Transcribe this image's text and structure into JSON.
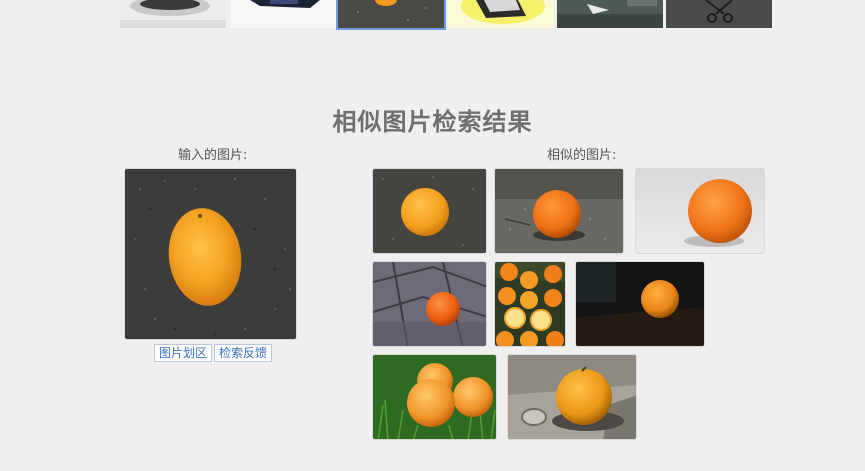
{
  "page": {
    "title": "相似图片检索结果"
  },
  "input_section": {
    "label": "输入的图片:",
    "buttons": {
      "crop": "图片划区",
      "feedback": "检索反馈"
    }
  },
  "similar_section": {
    "label": "相似的图片:"
  },
  "colors": {
    "background": "#efefef",
    "selected_outline": "#6a9fe6",
    "link_blue": "#3a6fbe",
    "orange": "#f08a1c"
  },
  "thumbnail_strip": {
    "selected_index": 2,
    "items": [
      "bowl-thumbnail",
      "dark-object-thumbnail",
      "orange-thumbnail",
      "yellow-box-thumbnail",
      "water-scene-thumbnail",
      "scissors-thumbnail"
    ]
  }
}
